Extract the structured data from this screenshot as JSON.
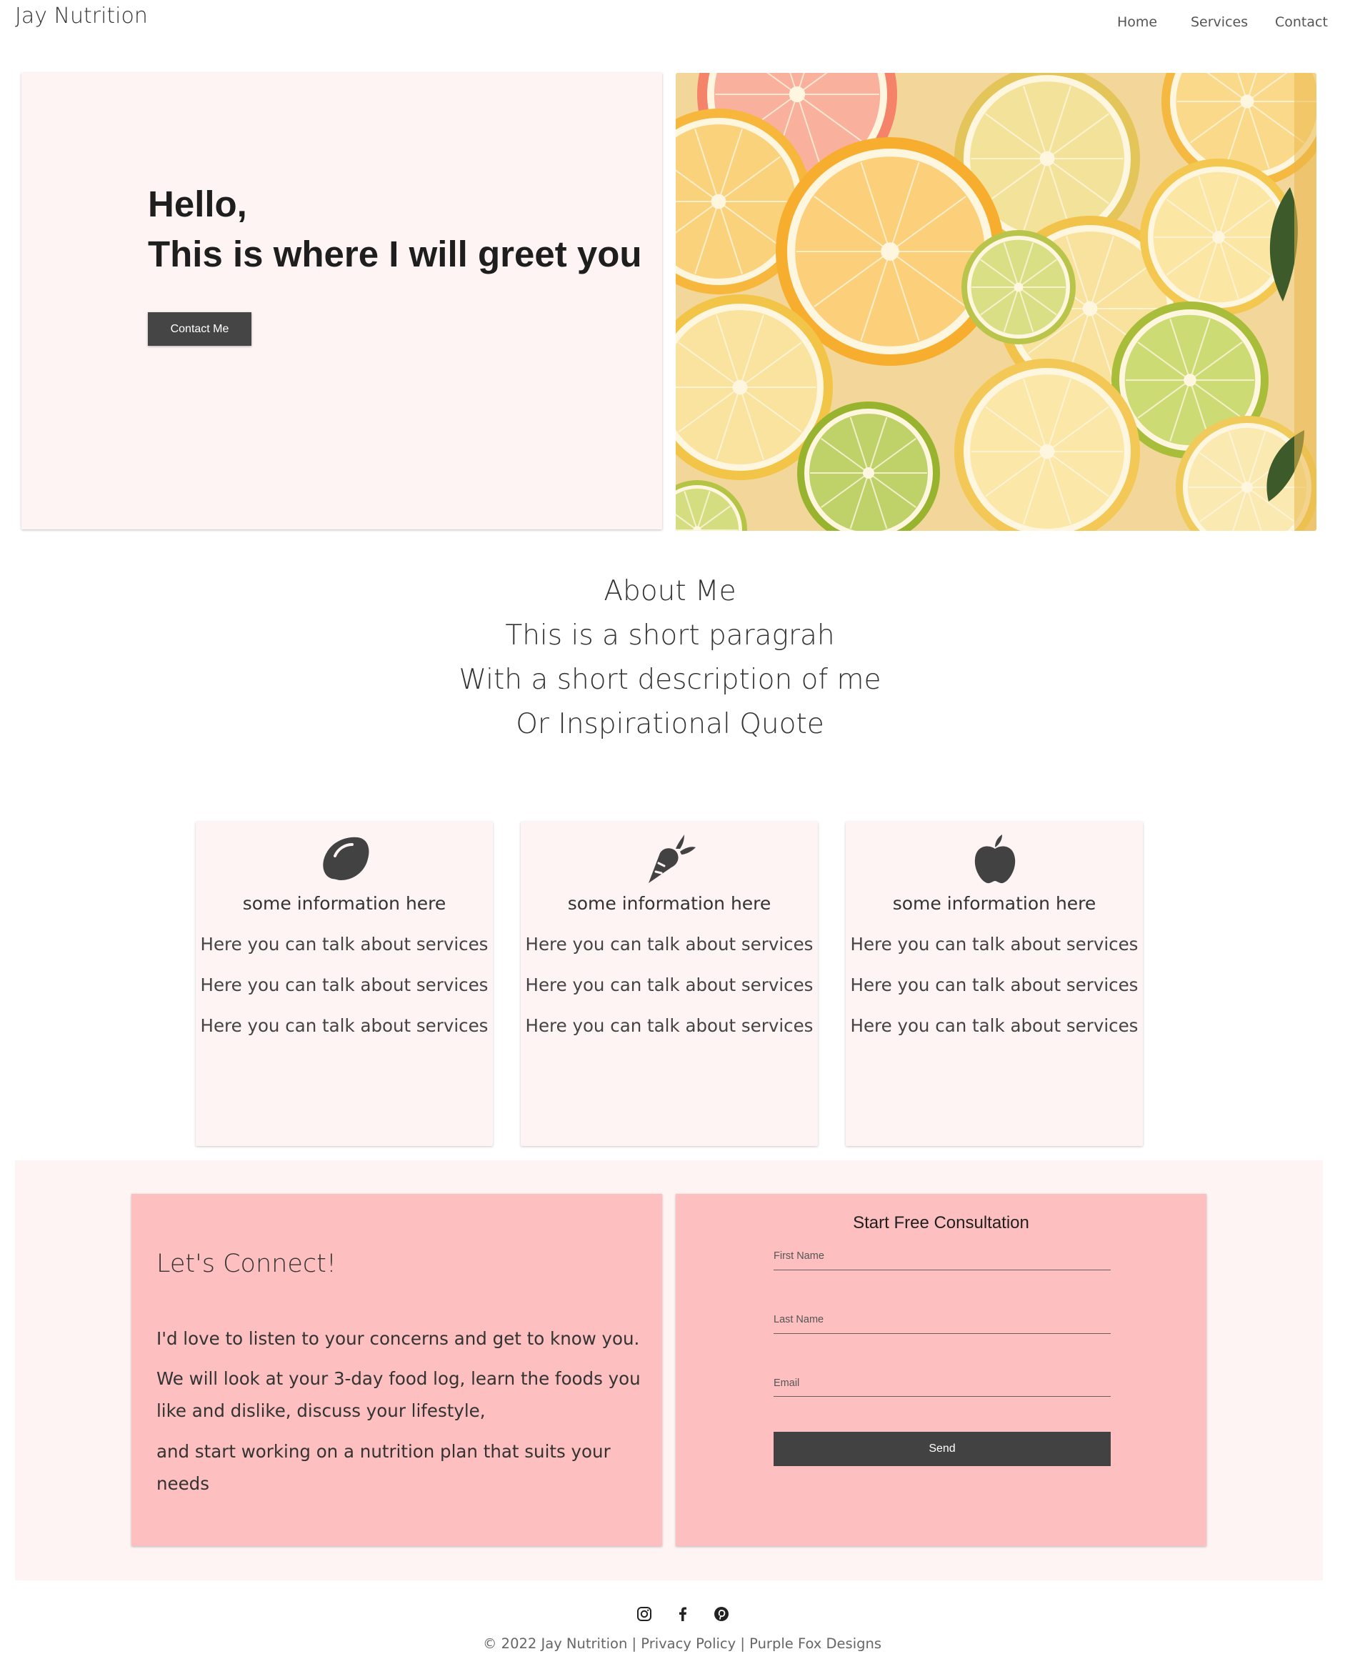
{
  "header": {
    "brand": "Jay Nutrition",
    "nav": [
      "Home",
      "Services",
      "Contact"
    ]
  },
  "hero": {
    "greeting_line1": "Hello,",
    "greeting_line2": "This is where I will greet you",
    "button_label": "Contact Me",
    "image": "citrus-slices-photo"
  },
  "about": {
    "lines": [
      "About Me",
      "This is a short paragrah",
      "With a short description of me",
      "Or Inspirational Quote"
    ]
  },
  "cards": [
    {
      "icon": "lemon-icon",
      "title": "some information here",
      "items": [
        "Here you can talk about services",
        "Here you can talk about services",
        "Here you can talk about services"
      ]
    },
    {
      "icon": "carrot-icon",
      "title": "some information here",
      "items": [
        "Here you can talk about services",
        "Here you can talk about services",
        "Here you can talk about services"
      ]
    },
    {
      "icon": "apple-icon",
      "title": "some information here",
      "items": [
        "Here you can talk about services",
        "Here you can talk about services",
        "Here you can talk about services"
      ]
    }
  ],
  "connect": {
    "title": "Let's Connect!",
    "paragraphs": [
      "I'd love to listen to your concerns and get to know you.",
      "We will look at your 3-day food log, learn the foods you like and dislike, discuss your lifestyle,",
      "and start working on a nutrition plan that suits your needs"
    ]
  },
  "form": {
    "title": "Start Free Consultation",
    "fields": [
      {
        "label": "First Name",
        "value": ""
      },
      {
        "label": "Last Name",
        "value": ""
      },
      {
        "label": "Email",
        "value": ""
      }
    ],
    "submit_label": "Send"
  },
  "footer": {
    "social": [
      "instagram-icon",
      "facebook-icon",
      "pinterest-icon"
    ],
    "copyright": "© 2022 Jay Nutrition",
    "privacy": "Privacy Policy",
    "credit": "Purple Fox Designs",
    "separator": " | "
  },
  "colors": {
    "panel_bg": "#fdf4f3",
    "pink_panel": "#fdbfbf",
    "dark_button": "#454545"
  }
}
